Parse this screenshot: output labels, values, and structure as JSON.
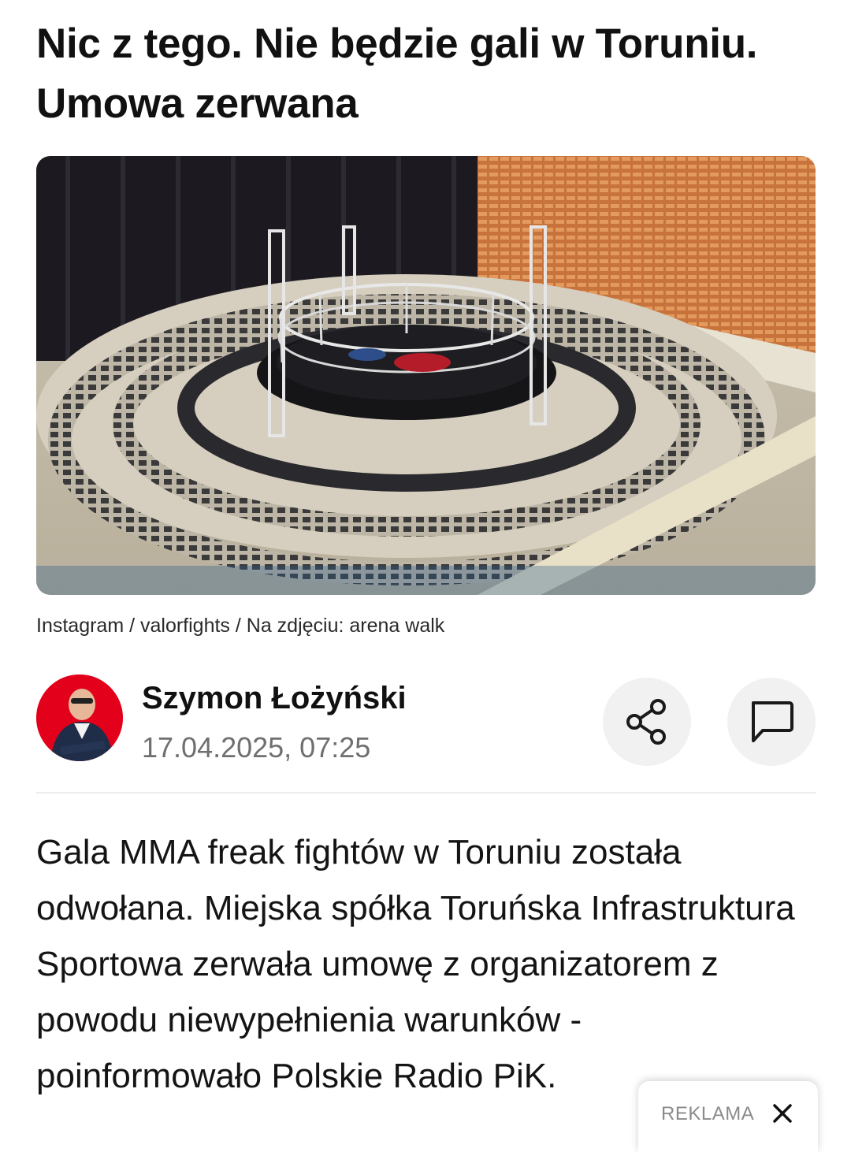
{
  "article": {
    "headline": "Nic z tego. Nie będzie gali w Toruniu. Umowa zerwana",
    "photo_caption": "Instagram / valorfights / Na zdjęciu: arena walk",
    "lead": "Gala MMA freak fightów w Toruniu została odwołana. Miejska spółka Toruńska Infrastruktura Sportowa zerwała umowę z organizatorem z powodu niewypełnienia warunków - poinformowało Polskie Radio PiK."
  },
  "author": {
    "name": "Szymon Łożyński",
    "datetime": "17.04.2025, 07:25",
    "avatar_bg": "#e3001b"
  },
  "actions": {
    "share_icon": "share-icon",
    "comment_icon": "comment-icon"
  },
  "ad": {
    "label": "REKLAMA",
    "close_icon": "close-icon"
  }
}
